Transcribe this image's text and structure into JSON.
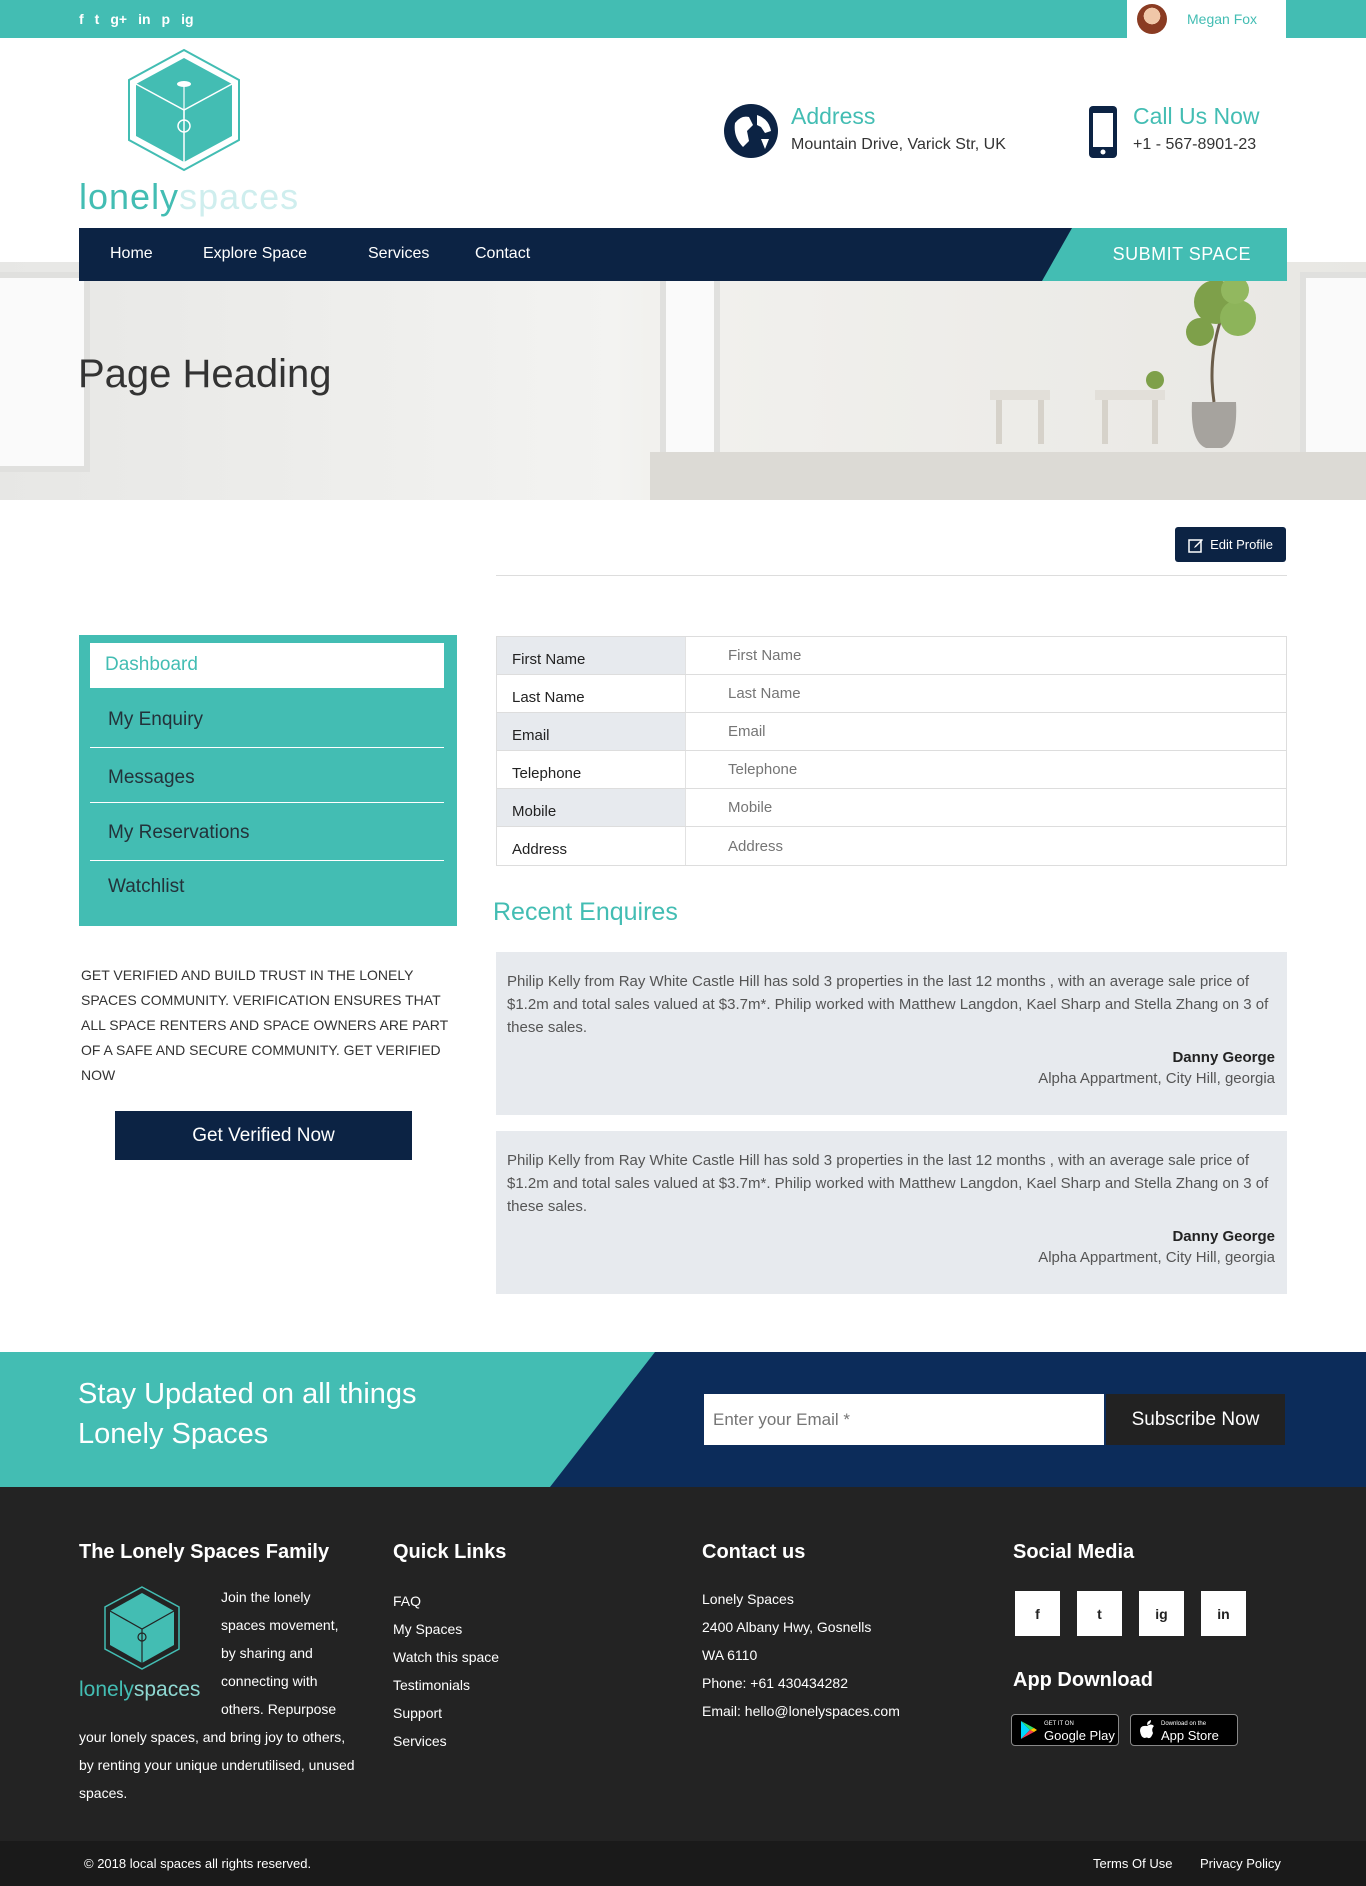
{
  "topbar": {
    "socials": [
      "f",
      "t",
      "g+",
      "in",
      "p",
      "ig"
    ],
    "user_name": "Megan Fox"
  },
  "logo": {
    "part1": "lonely",
    "part2": "spaces"
  },
  "header": {
    "address_title": "Address",
    "address_value": "Mountain Drive, Varick Str, UK",
    "call_title": "Call Us Now",
    "call_value": "+1 - 567-8901-23"
  },
  "nav": {
    "items": [
      "Home",
      "Explore Space",
      "Services",
      "Contact"
    ],
    "submit_label": "SUBMIT SPACE"
  },
  "hero": {
    "heading": "Page Heading"
  },
  "edit_profile_label": "Edit Profile",
  "sidebar": {
    "active": "Dashboard",
    "items": [
      "My Enquiry",
      "Messages",
      "My Reservations",
      "Watchlist"
    ]
  },
  "verify": {
    "text": "GET VERIFIED AND BUILD TRUST IN THE LONELY SPACES COMMUNITY. VERIFICATION ENSURES THAT ALL SPACE RENTERS AND SPACE OWNERS ARE PART OF A SAFE AND SECURE COMMUNITY. GET VERIFIED NOW",
    "button": "Get Verified Now"
  },
  "profile_fields": [
    {
      "label": "First Name",
      "placeholder": "First Name"
    },
    {
      "label": "Last Name",
      "placeholder": "Last Name"
    },
    {
      "label": "Email",
      "placeholder": "Email"
    },
    {
      "label": "Telephone",
      "placeholder": "Telephone"
    },
    {
      "label": "Mobile",
      "placeholder": "Mobile"
    },
    {
      "label": "Address",
      "placeholder": "Address"
    }
  ],
  "recent": {
    "title": "Recent Enquires",
    "items": [
      {
        "text": "Philip Kelly from Ray White Castle Hill has sold 3 properties in the last 12 months , with an average sale price of $1.2m and total sales valued at $3.7m*. Philip worked with Matthew Langdon, Kael Sharp and Stella Zhang on 3 of these sales.",
        "name": "Danny George",
        "address": "Alpha Appartment, City Hill, georgia"
      },
      {
        "text": "Philip Kelly from Ray White Castle Hill has sold 3 properties in the last 12 months , with an average sale price of $1.2m and total sales valued at $3.7m*. Philip worked with Matthew Langdon, Kael Sharp and Stella Zhang on 3 of these sales.",
        "name": "Danny George",
        "address": "Alpha Appartment, City Hill, georgia"
      }
    ]
  },
  "newsletter": {
    "title_line1": "Stay Updated on all things",
    "title_line2": "Lonely Spaces",
    "placeholder": "Enter your Email *",
    "button": "Subscribe Now"
  },
  "footer": {
    "family_title": "The Lonely Spaces Family",
    "family_text": "Join the lonely spaces movement, by sharing and connecting with others. Repurpose your lonely spaces, and bring joy to others, by renting your unique underutilised, unused spaces.",
    "links_title": "Quick Links",
    "links": [
      "FAQ",
      "My Spaces",
      "Watch this space",
      "Testimonials",
      "Support",
      "Services"
    ],
    "contact_title": "Contact us",
    "contact_lines": [
      "Lonely Spaces",
      "2400 Albany Hwy, Gosnells",
      "WA 6110",
      "Phone: +61 430434282",
      "Email: hello@lonelyspaces.com"
    ],
    "social_title": "Social Media",
    "social_icons": [
      "f",
      "t",
      "ig",
      "in"
    ],
    "app_title": "App Download",
    "google_small": "GET IT ON",
    "google_big": "Google Play",
    "apple_small": "Download on the",
    "apple_big": "App Store"
  },
  "bottom": {
    "copyright": "© 2018 local spaces all rights reserved.",
    "terms": "Terms Of Use",
    "privacy": "Privacy Policy"
  },
  "colors": {
    "teal": "#43bdb3",
    "navy": "#0c2344",
    "dark": "#232323"
  }
}
